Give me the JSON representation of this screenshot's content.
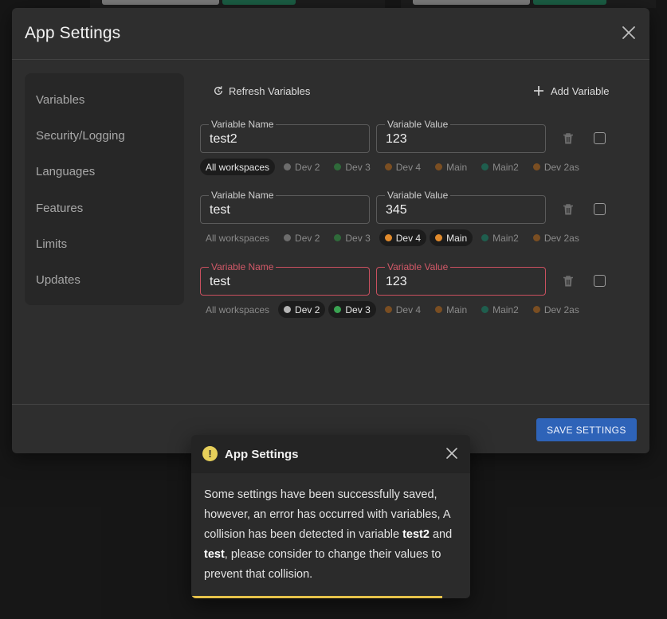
{
  "modal": {
    "title": "App Settings"
  },
  "sidebar": {
    "items": [
      {
        "label": "Variables",
        "active": true
      },
      {
        "label": "Security/Logging",
        "active": false
      },
      {
        "label": "Languages",
        "active": false
      },
      {
        "label": "Features",
        "active": false
      },
      {
        "label": "Limits",
        "active": false
      },
      {
        "label": "Updates",
        "active": false
      }
    ]
  },
  "toolbar": {
    "refresh_label": "Refresh Variables",
    "add_label": "Add Variable"
  },
  "field_labels": {
    "name": "Variable Name",
    "value": "Variable Value"
  },
  "variables": [
    {
      "name": "test2",
      "value": "123",
      "error": false,
      "workspaces": [
        {
          "label": "All workspaces",
          "selected": true,
          "dot": null
        },
        {
          "label": "Dev 2",
          "selected": false,
          "dot": "#6c6c6c"
        },
        {
          "label": "Dev 3",
          "selected": false,
          "dot": "#2f6a3a"
        },
        {
          "label": "Dev 4",
          "selected": false,
          "dot": "#7a4e22"
        },
        {
          "label": "Main",
          "selected": false,
          "dot": "#7a4e22"
        },
        {
          "label": "Main2",
          "selected": false,
          "dot": "#1f5e4e"
        },
        {
          "label": "Dev 2as",
          "selected": false,
          "dot": "#7a4e22"
        }
      ]
    },
    {
      "name": "test",
      "value": "345",
      "error": false,
      "workspaces": [
        {
          "label": "All workspaces",
          "selected": false,
          "dot": null
        },
        {
          "label": "Dev 2",
          "selected": false,
          "dot": "#6c6c6c"
        },
        {
          "label": "Dev 3",
          "selected": false,
          "dot": "#2f6a3a"
        },
        {
          "label": "Dev 4",
          "selected": true,
          "dot": "#e08a2c"
        },
        {
          "label": "Main",
          "selected": true,
          "dot": "#e08a2c"
        },
        {
          "label": "Main2",
          "selected": false,
          "dot": "#1f5e4e"
        },
        {
          "label": "Dev 2as",
          "selected": false,
          "dot": "#7a4e22"
        }
      ]
    },
    {
      "name": "test",
      "value": "123",
      "error": true,
      "workspaces": [
        {
          "label": "All workspaces",
          "selected": false,
          "dot": null
        },
        {
          "label": "Dev 2",
          "selected": true,
          "dot": "#b5b5b5"
        },
        {
          "label": "Dev 3",
          "selected": true,
          "dot": "#3aa352"
        },
        {
          "label": "Dev 4",
          "selected": false,
          "dot": "#7a4e22"
        },
        {
          "label": "Main",
          "selected": false,
          "dot": "#7a4e22"
        },
        {
          "label": "Main2",
          "selected": false,
          "dot": "#1f5e4e"
        },
        {
          "label": "Dev 2as",
          "selected": false,
          "dot": "#7a4e22"
        }
      ]
    }
  ],
  "footer": {
    "save_label": "SAVE SETTINGS"
  },
  "toast": {
    "title": "App Settings",
    "icon": "!",
    "line1": "Some settings have been successfully saved, however, an error has occurred with variables, A collision has been detected in variable ",
    "var1": "test2",
    "line2": " and ",
    "var2": "test",
    "line3": ", please consider to change their values to prevent that collision.",
    "progress_fraction": 0.9
  },
  "colors": {
    "accent": "#2e63b8",
    "error": "#c9505f",
    "warning": "#e6cf5a"
  }
}
